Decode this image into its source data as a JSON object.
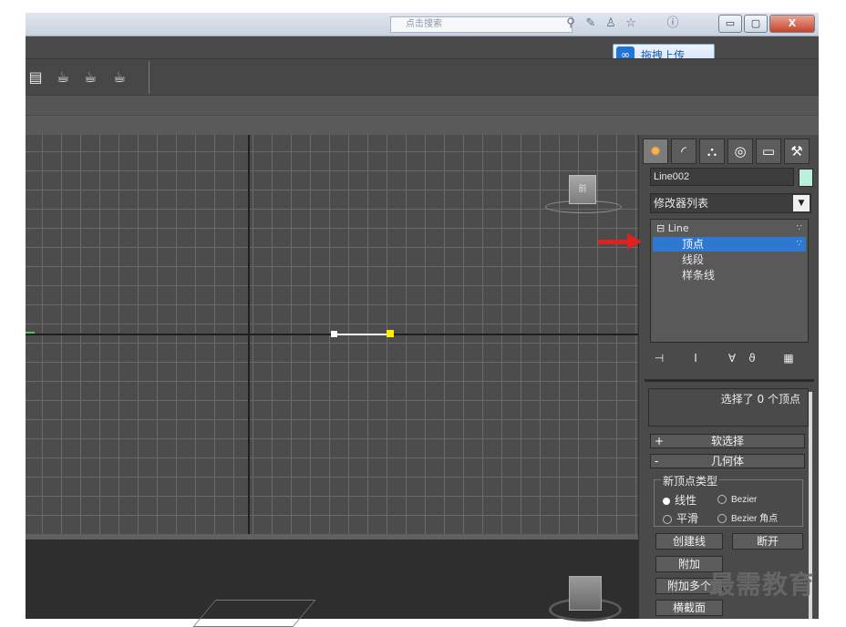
{
  "titlebar": {
    "address_placeholder": "点击搜索",
    "minimize_glyph": "▭",
    "maximize_glyph": "▢",
    "close_glyph": "X"
  },
  "upload": {
    "label": "拖拽上传",
    "logo_glyph": "∞"
  },
  "command_panel": {
    "object_name": "Line002",
    "object_color": "#b8f0da",
    "modifier_list": "修改器列表",
    "modifier_stack": [
      {
        "label": "Line"
      },
      {
        "label": "顶点",
        "selected": true
      },
      {
        "label": "线段"
      },
      {
        "label": "样条线"
      }
    ],
    "selection_status": "选择了 0 个顶点",
    "rollouts": {
      "soft_selection": {
        "sign": "+",
        "label": "软选择"
      },
      "geometry": {
        "sign": "-",
        "label": "几何体"
      }
    },
    "new_vertex_type": {
      "title": "新顶点类型",
      "options": [
        "线性",
        "Bezier",
        "平滑",
        "Bezier 角点"
      ],
      "selected": "线性"
    },
    "buttons": {
      "create_line": "创建线",
      "break": "断开",
      "attach": "附加",
      "attach_multiple": "附加多个",
      "cross_section": "横截面"
    }
  },
  "viewport": {
    "viewcube_label": "前",
    "selected_vertex_color": "#ffee00"
  },
  "watermark": "最需教育"
}
